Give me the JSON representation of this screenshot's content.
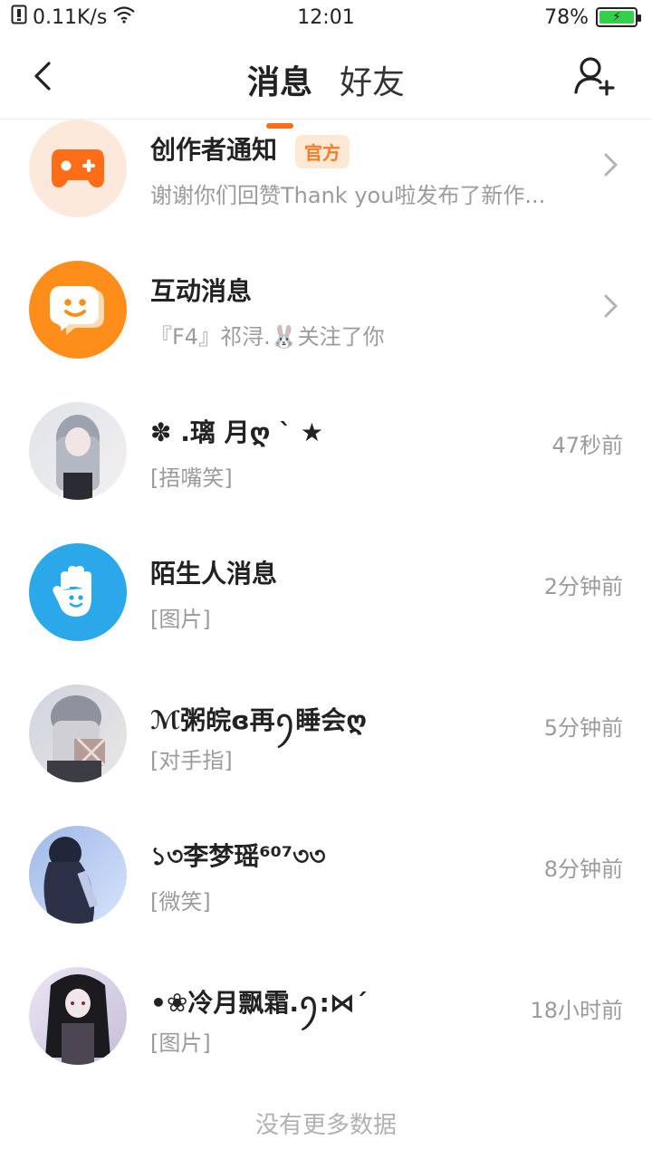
{
  "status_bar": {
    "network_speed": "0.11K/s",
    "time": "12:01",
    "battery_percent": "78%",
    "icons": [
      "sim-icon",
      "wifi-icon",
      "battery-charging-icon"
    ]
  },
  "header": {
    "tabs": [
      {
        "label": "消息",
        "active": true
      },
      {
        "label": "好友",
        "active": false
      }
    ],
    "back_icon": "chevron-left-icon",
    "add_friend_icon": "add-user-icon"
  },
  "conversations": [
    {
      "title": "创作者通知",
      "badge": "官方",
      "subtitle": "谢谢你们回赞Thank you啦发布了新作...",
      "time": "",
      "avatar_icon": "gamepad-icon",
      "has_chevron": true
    },
    {
      "title": "互动消息",
      "subtitle": "『F4』祁浔.🐰关注了你",
      "time": "",
      "avatar_icon": "chat-smile-icon",
      "has_chevron": true
    },
    {
      "title": "✽ .璃 月ღ ` ★",
      "subtitle": "[捂嘴笑]",
      "time": "47秒前",
      "avatar_icon": "user-avatar-image"
    },
    {
      "title": "陌生人消息",
      "subtitle": "[图片]",
      "time": "2分钟前",
      "avatar_icon": "hand-wave-icon"
    },
    {
      "title": "ℳ粥皖ɞ再ꪆ睡会ღ",
      "subtitle": "[对手指]",
      "time": "5分钟前",
      "avatar_icon": "user-avatar-image"
    },
    {
      "title": "১৩李梦瑶⁶⁰⁷৩৩",
      "subtitle": "[微笑]",
      "time": "8分钟前",
      "avatar_icon": "user-avatar-image"
    },
    {
      "title": "•❀冷月飘霜.ꪆ:⋈´",
      "subtitle": "[图片]",
      "time": "18小时前",
      "avatar_icon": "user-avatar-image"
    }
  ],
  "footer": {
    "text": "没有更多数据"
  },
  "colors": {
    "accent": "#ff6d17",
    "badge_bg": "#fde9d6",
    "badge_text": "#ff7a20",
    "secondary_text": "#9b9b9b",
    "notice_avatar_bg": "#fde9db",
    "interact_avatar_bg": "#fe8d1a",
    "stranger_avatar_bg": "#2aa8ea"
  }
}
